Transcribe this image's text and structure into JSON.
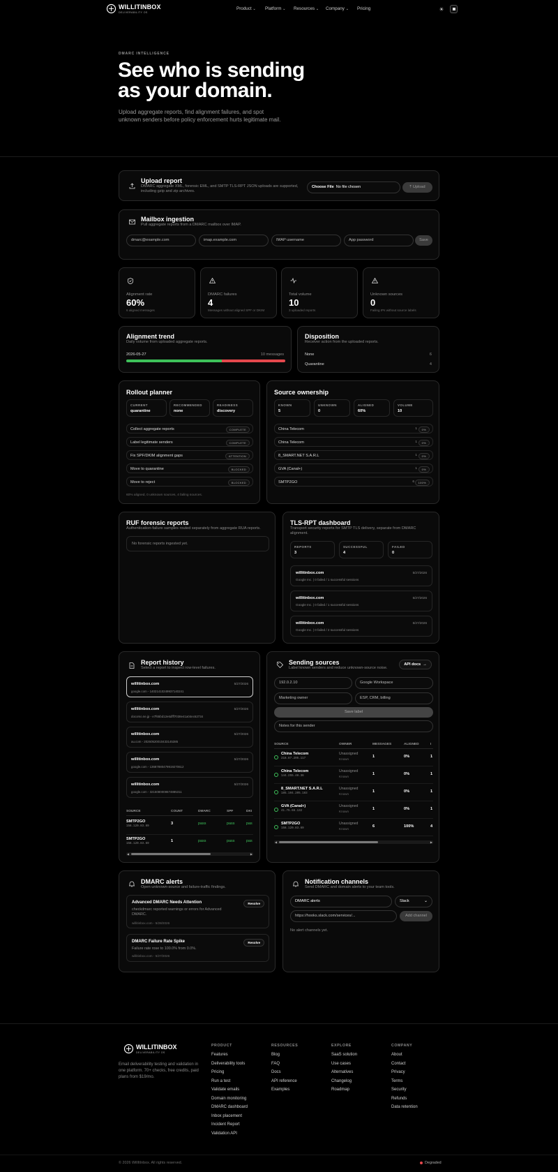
{
  "nav": {
    "brand": "WILLITINBOX",
    "brand_sub": "DELIVERABILITY OS",
    "links": [
      "Product",
      "Platform",
      "Resources",
      "Company",
      "Pricing"
    ]
  },
  "hero": {
    "eyebrow": "DMARC INTELLIGENCE",
    "title_1": "See who is sending",
    "title_2": "as your domain.",
    "sub_1": "Upload aggregate reports, find alignment failures, and spot",
    "sub_2": "unknown senders before policy enforcement hurts legitimate mail."
  },
  "upload": {
    "title": "Upload report",
    "desc_1": "DMARC aggregate XML, forensic EML, and SMTP TLS-RPT JSON uploads are supported,",
    "desc_2": "including gzip and zip archives.",
    "file_btn": "Choose File",
    "file_status": "No file chosen",
    "upload_btn": "Upload"
  },
  "mailbox": {
    "title": "Mailbox ingestion",
    "desc": "Pull aggregate reports from a DMARC mailbox over IMAP.",
    "ph_email": "dmarc@example.com",
    "ph_host": "imap.example.com",
    "ph_user": "IMAP username",
    "ph_pass": "App password",
    "save": "Save"
  },
  "stats": [
    {
      "label": "Alignment rate",
      "value": "60%",
      "note": "6 aligned messages"
    },
    {
      "label": "DMARC failures",
      "value": "4",
      "note": "Messages without aligned SPF or DKIM"
    },
    {
      "label": "Total volume",
      "value": "10",
      "note": "3 uploaded reports"
    },
    {
      "label": "Unknown sources",
      "value": "0",
      "note": "Failing IPs without source labels"
    }
  ],
  "trend": {
    "title": "Alignment trend",
    "desc": "Daily volume from uploaded aggregate reports.",
    "date": "2026-05-27",
    "count": "10 messages",
    "aligned_fraction": 0.6,
    "color_pass": "#3ec15a",
    "color_fail": "#e5484d"
  },
  "disposition": {
    "title": "Disposition",
    "desc": "Receiver action from the uploaded reports.",
    "rows": [
      {
        "label": "None",
        "value": "6"
      },
      {
        "label": "Quarantine",
        "value": "4"
      }
    ]
  },
  "rollout": {
    "title": "Rollout planner",
    "current_label": "CURRENT",
    "current": "quarantine",
    "rec_label": "RECOMMENDED",
    "rec": "none",
    "ready_label": "READINESS",
    "ready": "discovery",
    "steps": [
      {
        "label": "Collect aggregate reports",
        "status": "COMPLETE"
      },
      {
        "label": "Label legitimate senders",
        "status": "COMPLETE"
      },
      {
        "label": "Fix SPF/DKIM alignment gaps",
        "status": "ATTENTION"
      },
      {
        "label": "Move to quarantine",
        "status": "BLOCKED"
      },
      {
        "label": "Move to reject",
        "status": "BLOCKED"
      }
    ],
    "note": "60% aligned, 0 unknown sources, 4 failing sources."
  },
  "ownership": {
    "title": "Source ownership",
    "known_label": "KNOWN",
    "known": "5",
    "unknown_label": "UNKNOWN",
    "unknown": "0",
    "aligned_label": "ALIGNED",
    "aligned": "60%",
    "volume_label": "VOLUME",
    "volume": "10",
    "rows": [
      {
        "name": "China Telecom",
        "count": "1",
        "pct": "0%"
      },
      {
        "name": "China Telecom",
        "count": "1",
        "pct": "0%"
      },
      {
        "name": "8_SMART.NET S.A.R.L",
        "count": "1",
        "pct": "0%"
      },
      {
        "name": "GVA (Canal+)",
        "count": "1",
        "pct": "0%"
      },
      {
        "name": "SMTP2GO",
        "count": "6",
        "pct": "100%"
      }
    ]
  },
  "ruf": {
    "title": "RUF forensic reports",
    "desc": "Authentication-failure samples routed separately from aggregate RUA reports.",
    "empty": "No forensic reports ingested yet."
  },
  "tlsrpt": {
    "title": "TLS-RPT dashboard",
    "desc_1": "Transport security reports for SMTP TLS delivery, separate from DMARC",
    "desc_2": "alignment.",
    "reports_label": "REPORTS",
    "reports": "3",
    "success_label": "SUCCESSFUL",
    "success": "4",
    "failed_label": "FAILED",
    "failed": "0",
    "items": [
      {
        "domain": "willitinbox.com",
        "date": "5/27/2026",
        "detail": "Google Inc. | 0 failed / 1 successful sessions"
      },
      {
        "domain": "willitinbox.com",
        "date": "5/27/2026",
        "detail": "Google Inc. | 0 failed / 1 successful sessions"
      },
      {
        "domain": "willitinbox.com",
        "date": "5/27/2026",
        "detail": "Google Inc. | 0 failed / 2 successful sessions"
      }
    ]
  },
  "history": {
    "title": "Report history",
    "desc": "Select a report to inspect row-level failures.",
    "items": [
      {
        "domain": "willitinbox.com",
        "date": "5/27/2026",
        "id": "google.com - 14021410249937140241"
      },
      {
        "domain": "willitinbox.com",
        "date": "5/27/2026",
        "id": "docomo.ne.jp - e7f65bd12e6dfff7038e41a04ec62734"
      },
      {
        "domain": "willitinbox.com",
        "date": "5/27/2026",
        "id": "au.com - 20260520010433145385"
      },
      {
        "domain": "willitinbox.com",
        "date": "5/27/2026",
        "id": "google.com - 13687880479919270612"
      },
      {
        "domain": "willitinbox.com",
        "date": "5/27/2026",
        "id": "google.com - 3215080008674885311"
      }
    ],
    "cols": [
      "SOURCE",
      "COUNT",
      "DMARC",
      "SPF",
      "DKI"
    ],
    "rows": [
      {
        "source": "SMTP2GO",
        "ip": "158.120.83.69",
        "count": "3",
        "dmarc": "pass",
        "spf": "pass",
        "dkim": "pas"
      },
      {
        "source": "SMTP2GO",
        "ip": "158.120.83.69",
        "count": "1",
        "dmarc": "pass",
        "spf": "pass",
        "dkim": "pas"
      }
    ]
  },
  "sending": {
    "title": "Sending sources",
    "desc": "Label known senders and reduce unknown-source noise.",
    "api": "API docs",
    "ph_ip": "192.0.2.10",
    "ph_provider": "Google Workspace",
    "ph_owner": "Marketing owner",
    "ph_use": "ESP, CRM, billing",
    "save": "Save label",
    "ph_notes": "Notes for this sender",
    "cols": [
      "SOURCE",
      "OWNER",
      "MESSAGES",
      "ALIGNED",
      "I"
    ],
    "rows": [
      {
        "name": "China Telecom",
        "ip": "218.87.205.117",
        "owner": "Unassigned",
        "state": "Known",
        "messages": "1",
        "aligned": "0%",
        "extra": "1"
      },
      {
        "name": "China Telecom",
        "ip": "144.255.48.36",
        "owner": "Unassigned",
        "state": "Known",
        "messages": "1",
        "aligned": "0%",
        "extra": "1"
      },
      {
        "name": "8_SMART.NET S.A.R.L",
        "ip": "185.104.205.183",
        "owner": "Unassigned",
        "state": "Known",
        "messages": "1",
        "aligned": "0%",
        "extra": "1"
      },
      {
        "name": "GVA (Canal+)",
        "ip": "41.75.66.132",
        "owner": "Unassigned",
        "state": "Known",
        "messages": "1",
        "aligned": "0%",
        "extra": "1"
      },
      {
        "name": "SMTP2GO",
        "ip": "158.120.83.69",
        "owner": "Unassigned",
        "state": "Known",
        "messages": "6",
        "aligned": "100%",
        "extra": "4"
      }
    ]
  },
  "alerts": {
    "title": "DMARC alerts",
    "desc": "Open unknown-source and failure-traffic findings.",
    "resolve": "Resolve",
    "items": [
      {
        "title": "Advanced DMARC Needs Attention",
        "body_1": "checkdmarc reported warnings or errors for Advanced",
        "body_2": "DMARC.",
        "meta": "willitinbox.com - 5/28/2026"
      },
      {
        "title": "DMARC Failure Rate Spike",
        "body_1": "Failure rate rose to 100.0% from 0.0%.",
        "body_2": "",
        "meta": "willitinbox.com - 5/27/2026"
      }
    ]
  },
  "channels": {
    "title": "Notification channels",
    "desc": "Send DMARC and domain alerts to your team tools.",
    "name_val": "DMARC alerts",
    "type_val": "Slack",
    "ph_url": "https://hooks.slack.com/services/...",
    "add": "Add channel",
    "empty": "No alert channels yet."
  },
  "footer": {
    "brand": "WILLITINBOX",
    "brand_sub": "DELIVERABILITY OS",
    "tag_1": "Email deliverability testing and validation in",
    "tag_2": "one platform. 70+ checks, free credits, paid",
    "tag_3": "plans from $19/mo.",
    "product_h": "PRODUCT",
    "product": [
      "Features",
      "Deliverability tools",
      "Pricing",
      "Run a test",
      "Validate emails",
      "Domain monitoring",
      "DMARC dashboard",
      "Inbox placement",
      "Incident Report",
      "Validation API"
    ],
    "resources_h": "RESOURCES",
    "resources": [
      "Blog",
      "FAQ",
      "Docs",
      "API reference",
      "Examples"
    ],
    "explore_h": "EXPLORE",
    "explore": [
      "SaaS solution",
      "Use cases",
      "Alternatives",
      "Changelog",
      "Roadmap"
    ],
    "company_h": "COMPANY",
    "company": [
      "About",
      "Contact",
      "Privacy",
      "Terms",
      "Security",
      "Refunds",
      "Data retention"
    ],
    "copyright": "© 2026 WillItInbox. All rights reserved.",
    "status": "Degraded",
    "status_color": "#e5484d"
  }
}
